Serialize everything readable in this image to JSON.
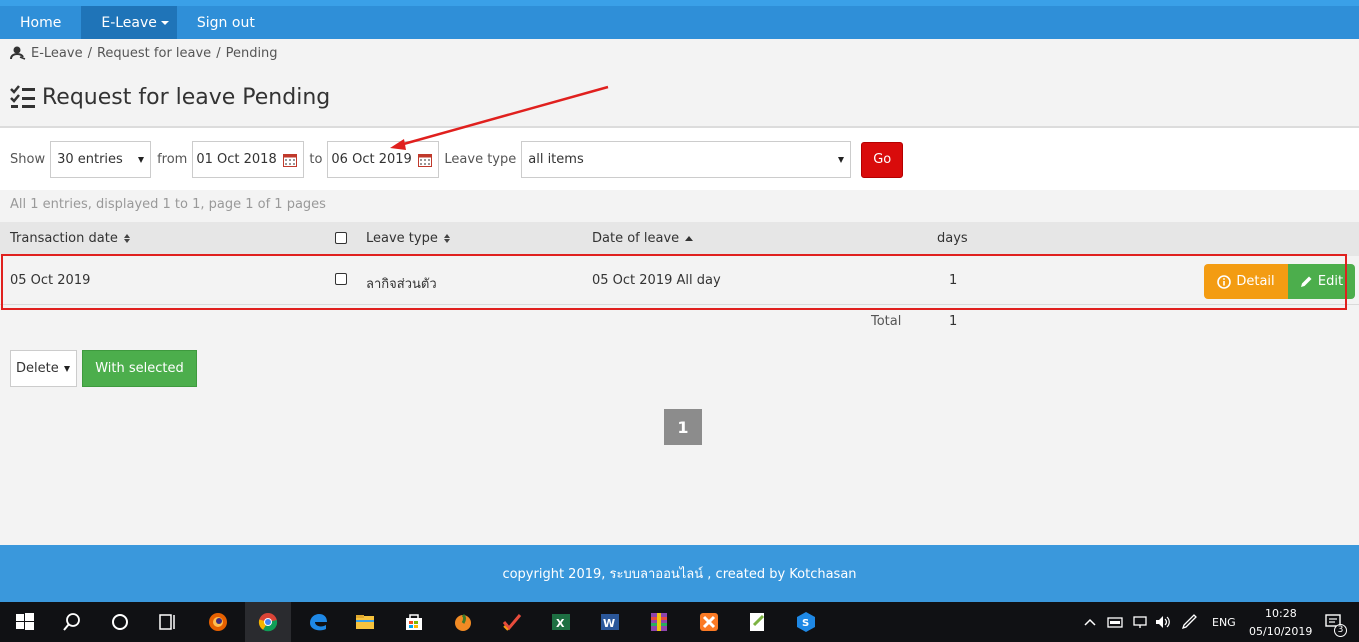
{
  "nav": {
    "items": [
      {
        "label": "Home"
      },
      {
        "label": "E-Leave"
      },
      {
        "label": "Sign out"
      }
    ]
  },
  "breadcrumb": {
    "items": [
      "E-Leave",
      "Request for leave",
      "Pending"
    ],
    "separator": "/"
  },
  "page": {
    "title": "Request for leave Pending"
  },
  "filters": {
    "show_label": "Show",
    "entries": "30 entries",
    "from_label": "from",
    "from_date": "01 Oct 2018",
    "to_label": "to",
    "to_date": "06 Oct 2019",
    "leave_type_label": "Leave type",
    "leave_type": "all items",
    "go_label": "Go"
  },
  "summary": "All 1 entries, displayed 1 to 1, page 1 of 1 pages",
  "table": {
    "columns": [
      "Transaction date",
      "Leave type",
      "Date of leave",
      "days"
    ],
    "rows": [
      {
        "transaction_date": "05 Oct 2019",
        "leave_type": "ลากิจส่วนตัว",
        "date_of_leave": "05 Oct 2019 All day",
        "days": "1"
      }
    ],
    "detail_label": "Detail",
    "edit_label": "Edit",
    "total_label": "Total",
    "total_value": "1"
  },
  "actions": {
    "bulk_select": "Delete",
    "with_selected": "With selected"
  },
  "pagination": {
    "current": "1"
  },
  "footer": {
    "text": "copyright 2019, ระบบลาออนไลน์ , created by Kotchasan"
  },
  "taskbar": {
    "language": "ENG",
    "time": "10:28",
    "date": "05/10/2019",
    "notifications": "3"
  },
  "colors": {
    "nav_bg": "#2f8fd8",
    "go_button": "#d90b0b",
    "detail_button": "#f39c12",
    "edit_button": "#4cae4c",
    "highlight": "#e0201e",
    "footer_bg": "#3a98dc"
  }
}
